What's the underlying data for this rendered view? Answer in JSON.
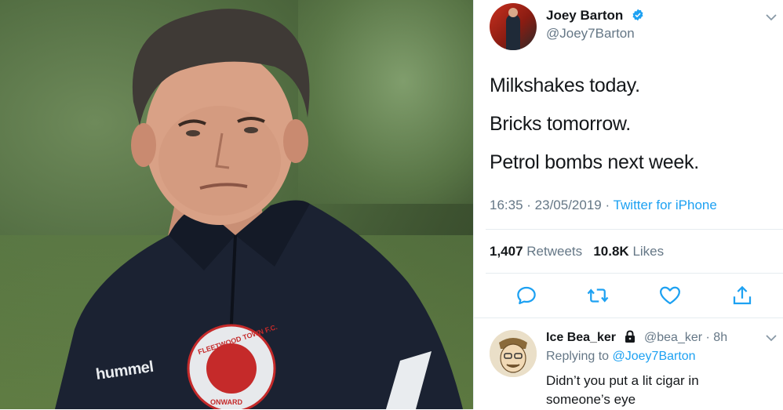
{
  "tweet": {
    "author_name": "Joey Barton",
    "author_handle": "@Joey7Barton",
    "lines": [
      "Milkshakes today.",
      "Bricks tomorrow.",
      "Petrol bombs next week."
    ],
    "time": "16:35",
    "separator1": " · ",
    "date": "23/05/2019",
    "separator2": " · ",
    "source": "Twitter for iPhone",
    "retweets_count": "1,407",
    "retweets_label": "Retweets",
    "likes_count": "10.8K",
    "likes_label": "Likes"
  },
  "reply": {
    "author_name": "Ice Bea_ker",
    "author_handle": "@bea_ker",
    "age": "· 8h",
    "replying_prefix": "Replying to ",
    "replying_to": "@Joey7Barton",
    "text": "Didn’t you put a lit cigar in someone’s eye"
  },
  "photo": {
    "jacket_brand": "hummel",
    "crest_text": "FLEETWOOD TOWN F.C.",
    "crest_motto": "ONWARD"
  },
  "colors": {
    "accent": "#1da1f2",
    "text": "#14171a",
    "muted": "#657786",
    "divider": "#e6ecf0"
  },
  "icons": [
    "verified-badge-icon",
    "chevron-down-icon",
    "reply-icon",
    "retweet-icon",
    "like-icon",
    "share-icon",
    "lock-icon"
  ]
}
